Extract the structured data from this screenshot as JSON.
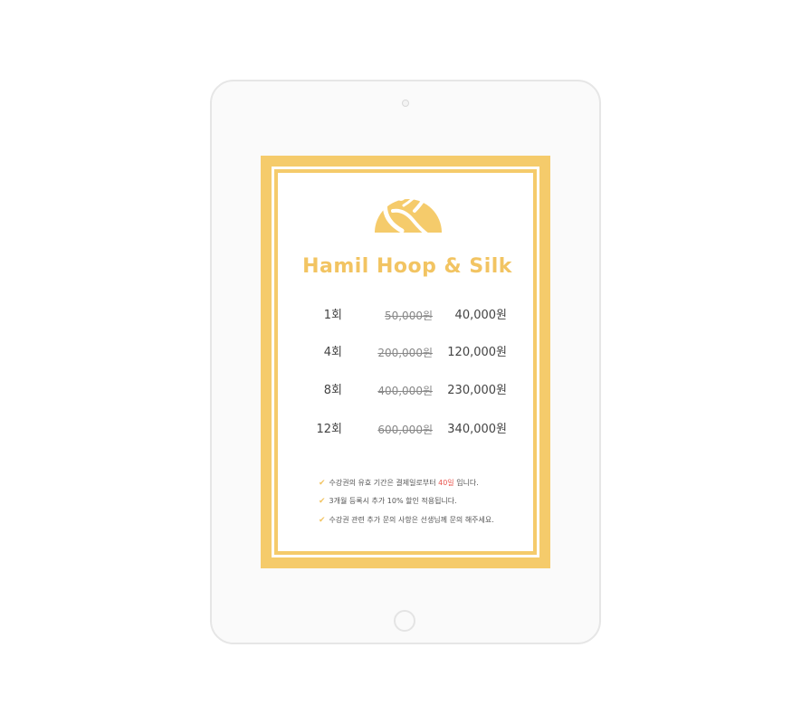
{
  "brand": {
    "name": "Hamil Hoop & Silk"
  },
  "prices": [
    {
      "count": "1회",
      "original": "50,000원",
      "sale": "40,000원"
    },
    {
      "count": "4회",
      "original": "200,000원",
      "sale": "120,000원"
    },
    {
      "count": "8회",
      "original": "400,000원",
      "sale": "230,000원"
    },
    {
      "count": "12회",
      "original": "600,000원",
      "sale": "340,000원"
    }
  ],
  "notes": {
    "note1": {
      "before": "수강권의 유효 기간은 결제일로부터 ",
      "highlight": "40일",
      "after": " 입니다."
    },
    "note2": "3개월 등록시 추가 10% 할인 적용됩니다.",
    "note3": "수강권 관련 추가 문의 사항은 선생님께 문의 해주세요."
  },
  "icons": {
    "logo": "aerial-hoop-dancer-logo",
    "check": "check-icon"
  },
  "colors": {
    "accent": "#f5cb6b",
    "highlight": "#e8554e"
  }
}
